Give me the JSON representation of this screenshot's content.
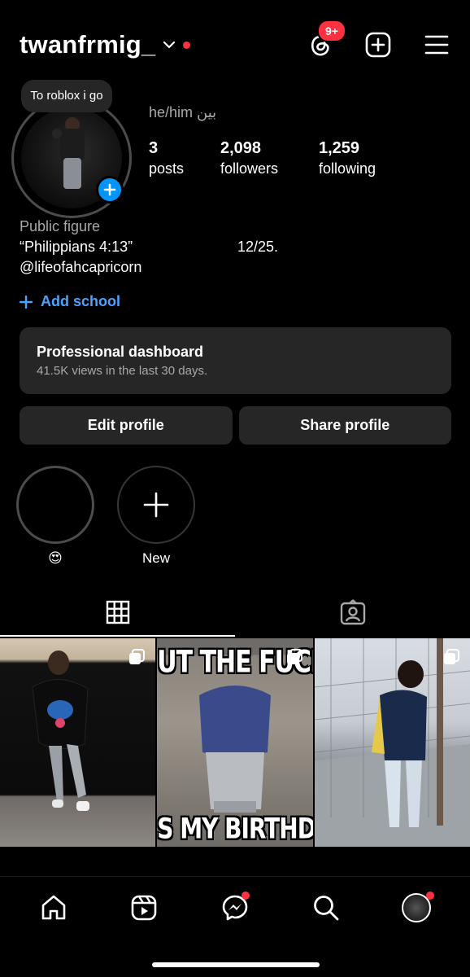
{
  "header": {
    "username": "twanfrmig_",
    "threads_badge": "9+"
  },
  "profile": {
    "note": "To roblox i go",
    "pronouns": "he/him بين",
    "stats": [
      {
        "num": "3",
        "label": "posts"
      },
      {
        "num": "2,098",
        "label": "followers"
      },
      {
        "num": "1,259",
        "label": "following"
      }
    ],
    "category": "Public figure",
    "bio_quote": "“Philippians 4:13”",
    "bio_date": "12/25.",
    "bio_handle": "@lifeofahcapricorn",
    "add_school": "Add school"
  },
  "dashboard": {
    "title": "Professional dashboard",
    "subtitle": "41.5K views in the last 30 days."
  },
  "buttons": {
    "edit": "Edit profile",
    "share": "Share profile"
  },
  "highlights": [
    {
      "label": "😍"
    },
    {
      "label": "New"
    }
  ],
  "tabs": [
    "grid-icon",
    "tagged-icon"
  ],
  "posts": [
    {
      "id": "post-1"
    },
    {
      "id": "post-2",
      "top_text": "UT THE FUCK U",
      "bottom_text": "S MY BIRTHDAY"
    },
    {
      "id": "post-3"
    }
  ],
  "nav": [
    "home-icon",
    "reels-icon",
    "messenger-icon",
    "search-icon",
    "profile-avatar"
  ],
  "colors": {
    "accent_blue": "#0095f6",
    "link_blue": "#4aa3ff",
    "notification_red": "#ff3040",
    "surface": "#262626"
  }
}
